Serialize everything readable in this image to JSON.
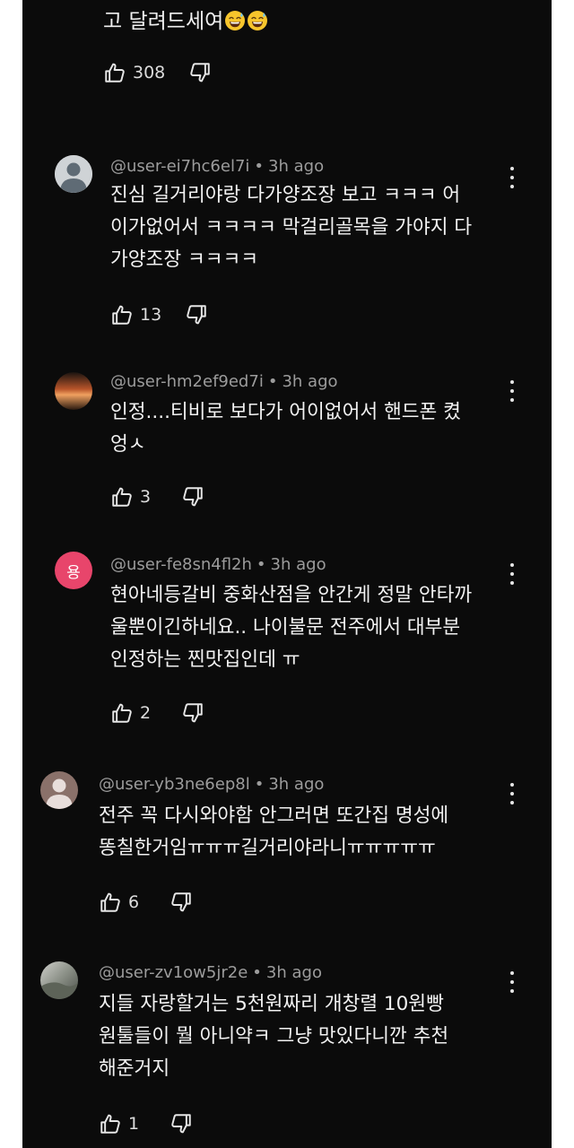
{
  "top_reply": {
    "text_tail": "고 달려드세여",
    "emojis": [
      "grinning-sweat-face",
      "grinning-sweat-face"
    ],
    "likes": "308"
  },
  "comments": [
    {
      "user": "@user-ei7hc6el7i",
      "time": "3h ago",
      "text": "진심 길거리야랑 다가양조장 보고 ㅋㅋㅋ 어\n이가없어서 ㅋㅋㅋㅋ 막걸리골목을 가야지 다\n가양조장 ㅋㅋㅋㅋ",
      "likes": "13",
      "avatar_type": "default-gray"
    },
    {
      "user": "@user-hm2ef9ed7i",
      "time": "3h ago",
      "text": "인정....티비로 보다가 어이없어서 핸드폰 켰\n엉ㅅ",
      "likes": "3",
      "avatar_type": "sunset-photo"
    },
    {
      "user": "@user-fe8sn4fl2h",
      "time": "3h ago",
      "text": "현아네등갈비 중화산점을 안간게 정말 안타까\n울뿐이긴하네요.. 나이불문 전주에서 대부분\n인정하는 찐맛집인데 ㅠ",
      "likes": "2",
      "avatar_type": "letter",
      "avatar_letter": "용",
      "avatar_color": "#e8456b"
    },
    {
      "user": "@user-yb3ne6ep8l",
      "time": "3h ago",
      "text": "전주 꼭 다시와야함 안그러면 또간집 명성에\n똥칠한거임ㅠㅠㅠ길거리야라니ㅠㅠㅠㅠㅠ",
      "likes": "6",
      "avatar_type": "default-brown"
    },
    {
      "user": "@user-zv1ow5jr2e",
      "time": "3h ago",
      "text": "지들 자랑할거는 5천원짜리 개창렬 10원빵\n원툴들이 뭘 아니약ㅋ 그냥 맛있다니깐 추천\n해준거지",
      "likes": "1",
      "avatar_type": "gray-photo"
    }
  ],
  "colors": {
    "background": "#0b0b0b",
    "text": "#f2f2f2",
    "meta_text": "#9c9c9c",
    "icon": "#e6e6e6",
    "outer_margin": "#ffffff"
  },
  "icons": {
    "like": "thumbs-up-outline-icon",
    "dislike": "thumbs-down-outline-icon",
    "more": "more-vertical-icon"
  }
}
